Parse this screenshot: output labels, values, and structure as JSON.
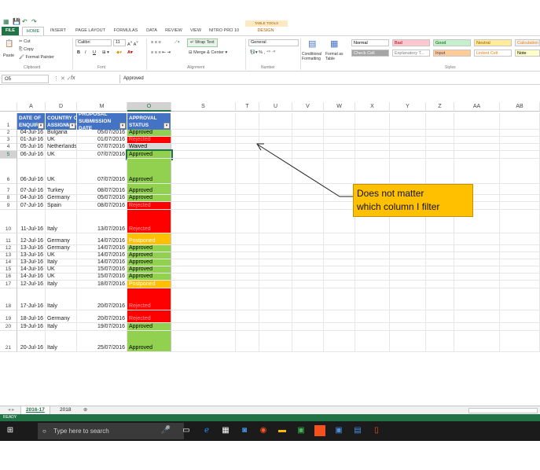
{
  "quick_access": [
    "💾",
    "↶",
    "↷"
  ],
  "table_tools": "TABLE TOOLS",
  "tabs": [
    "FILE",
    "HOME",
    "INSERT",
    "PAGE LAYOUT",
    "FORMULAS",
    "DATA",
    "REVIEW",
    "VIEW",
    "NITRO PRO 10",
    "DESIGN"
  ],
  "ribbon": {
    "paste": "Paste",
    "cut": "Cut",
    "copy": "Copy",
    "format_painter": "Format Painter",
    "clipboard": "Clipboard",
    "font_name": "Calibri",
    "font_size": "11",
    "bold": "B",
    "italic": "I",
    "underline": "U",
    "font": "Font",
    "wrap_text": "Wrap Text",
    "merge_center": "Merge & Center",
    "alignment": "Alignment",
    "number_format": "General",
    "number": "Number",
    "conditional_formatting": "Conditional Formatting",
    "format_as_table": "Format as Table",
    "styles": "Styles",
    "style_cells": [
      {
        "label": "Normal",
        "bg": "#ffffff",
        "fg": "#000000"
      },
      {
        "label": "Bad",
        "bg": "#ffc7ce",
        "fg": "#9c0006"
      },
      {
        "label": "Good",
        "bg": "#c6efce",
        "fg": "#006100"
      },
      {
        "label": "Neutral",
        "bg": "#ffeb9c",
        "fg": "#9c5700"
      },
      {
        "label": "Calculation",
        "bg": "#f2f2f2",
        "fg": "#fa7d00"
      },
      {
        "label": "Check Cell",
        "bg": "#a5a5a5",
        "fg": "#ffffff"
      },
      {
        "label": "Explanatory T...",
        "bg": "#ffffff",
        "fg": "#7f7f7f"
      },
      {
        "label": "Input",
        "bg": "#ffcc99",
        "fg": "#3f3f76"
      },
      {
        "label": "Linked Cell",
        "bg": "#ffffff",
        "fg": "#fa7d00"
      },
      {
        "label": "Note",
        "bg": "#ffffcc",
        "fg": "#000000"
      }
    ]
  },
  "formula_bar": {
    "name_box": "O5",
    "fx": "fx",
    "value": "Approved"
  },
  "columns": [
    "A",
    "D",
    "M",
    "O",
    "S",
    "T",
    "U",
    "V",
    "W",
    "X",
    "Y",
    "Z",
    "AA",
    "AB"
  ],
  "table_headers": [
    "DATE OF ENQUIRY",
    "COUNTRY OF ASSIGNMENT",
    "PROPOSAL SUBMISSION DATE",
    "APPROVAL STATUS"
  ],
  "filter_glyph": "▾",
  "rows": [
    {
      "num": "2",
      "a": "04-Jul-16",
      "d": "Bulgaria",
      "m": "05/07/2016",
      "o": "Approved",
      "status": "approved"
    },
    {
      "num": "3",
      "a": "01-Jul-16",
      "d": "UK",
      "m": "01/07/2016",
      "o": "Rejected",
      "status": "rejected"
    },
    {
      "num": "4",
      "a": "05-Jul-16",
      "d": "Netherlands",
      "m": "07/07/2016",
      "o": "Waived",
      "status": "waived"
    },
    {
      "num": "5",
      "a": "06-Jul-16",
      "d": "UK",
      "m": "07/07/2016",
      "o": "Approved",
      "status": "approved"
    },
    {
      "num": "6",
      "a": "06-Jul-16",
      "d": "UK",
      "m": "07/07/2016",
      "o": "Approved",
      "status": "approved"
    },
    {
      "num": "7",
      "a": "07-Jul-16",
      "d": "Turkey",
      "m": "08/07/2016",
      "o": "Approved",
      "status": "approved"
    },
    {
      "num": "8",
      "a": "04-Jul-16",
      "d": "Germany",
      "m": "05/07/2016",
      "o": "Approved",
      "status": "approved"
    },
    {
      "num": "9",
      "a": "07-Jul-16",
      "d": "Spain",
      "m": "08/07/2016",
      "o": "Rejected",
      "status": "rejected"
    },
    {
      "num": "10",
      "a": "11-Jul-16",
      "d": "Italy",
      "m": "13/07/2016",
      "o": "Rejected",
      "status": "rejected"
    },
    {
      "num": "11",
      "a": "12-Jul-16",
      "d": "Germany",
      "m": "14/07/2016",
      "o": "Postponed",
      "status": "postponed"
    },
    {
      "num": "12",
      "a": "13-Jul-16",
      "d": "Germany",
      "m": "14/07/2016",
      "o": "Approved",
      "status": "approved"
    },
    {
      "num": "13",
      "a": "13-Jul-16",
      "d": "UK",
      "m": "14/07/2016",
      "o": "Approved",
      "status": "approved"
    },
    {
      "num": "14",
      "a": "13-Jul-16",
      "d": "Italy",
      "m": "14/07/2016",
      "o": "Approved",
      "status": "approved"
    },
    {
      "num": "15",
      "a": "14-Jul-16",
      "d": "UK",
      "m": "15/07/2016",
      "o": "Approved",
      "status": "approved"
    },
    {
      "num": "16",
      "a": "14-Jul-16",
      "d": "UK",
      "m": "15/07/2016",
      "o": "Approved",
      "status": "approved"
    },
    {
      "num": "17",
      "a": "12-Jul-16",
      "d": "Italy",
      "m": "18/07/2016",
      "o": "Postponed",
      "status": "postponed"
    },
    {
      "num": "18",
      "a": "17-Jul-16",
      "d": "Italy",
      "m": "20/07/2016",
      "o": "Rejected",
      "status": "rejected"
    },
    {
      "num": "19",
      "a": "18-Jul-16",
      "d": "Germany",
      "m": "20/07/2016",
      "o": "Rejected",
      "status": "rejected"
    },
    {
      "num": "20",
      "a": "19-Jul-16",
      "d": "Italy",
      "m": "19/07/2016",
      "o": "Approved",
      "status": "approved"
    },
    {
      "num": "21",
      "a": "20-Jul-16",
      "d": "Italy",
      "m": "25/07/2016",
      "o": "Approved",
      "status": "approved"
    }
  ],
  "status_colors": {
    "approved": {
      "bg": "#92d050",
      "fg": "#000000"
    },
    "rejected": {
      "bg": "#ff0000",
      "fg": "#ff9999"
    },
    "waived": {
      "bg": "#d9d9d9",
      "fg": "#000000"
    },
    "postponed": {
      "bg": "#ffc000",
      "fg": "#ffffff"
    }
  },
  "callout": {
    "line1": "Does not matter",
    "line2": "which column I filter"
  },
  "sheets": [
    "2016-17",
    "2018"
  ],
  "add_sheet": "⊕",
  "status_bar": "READY",
  "taskbar": {
    "search_placeholder": "Type here to search"
  },
  "accent": "#217346"
}
